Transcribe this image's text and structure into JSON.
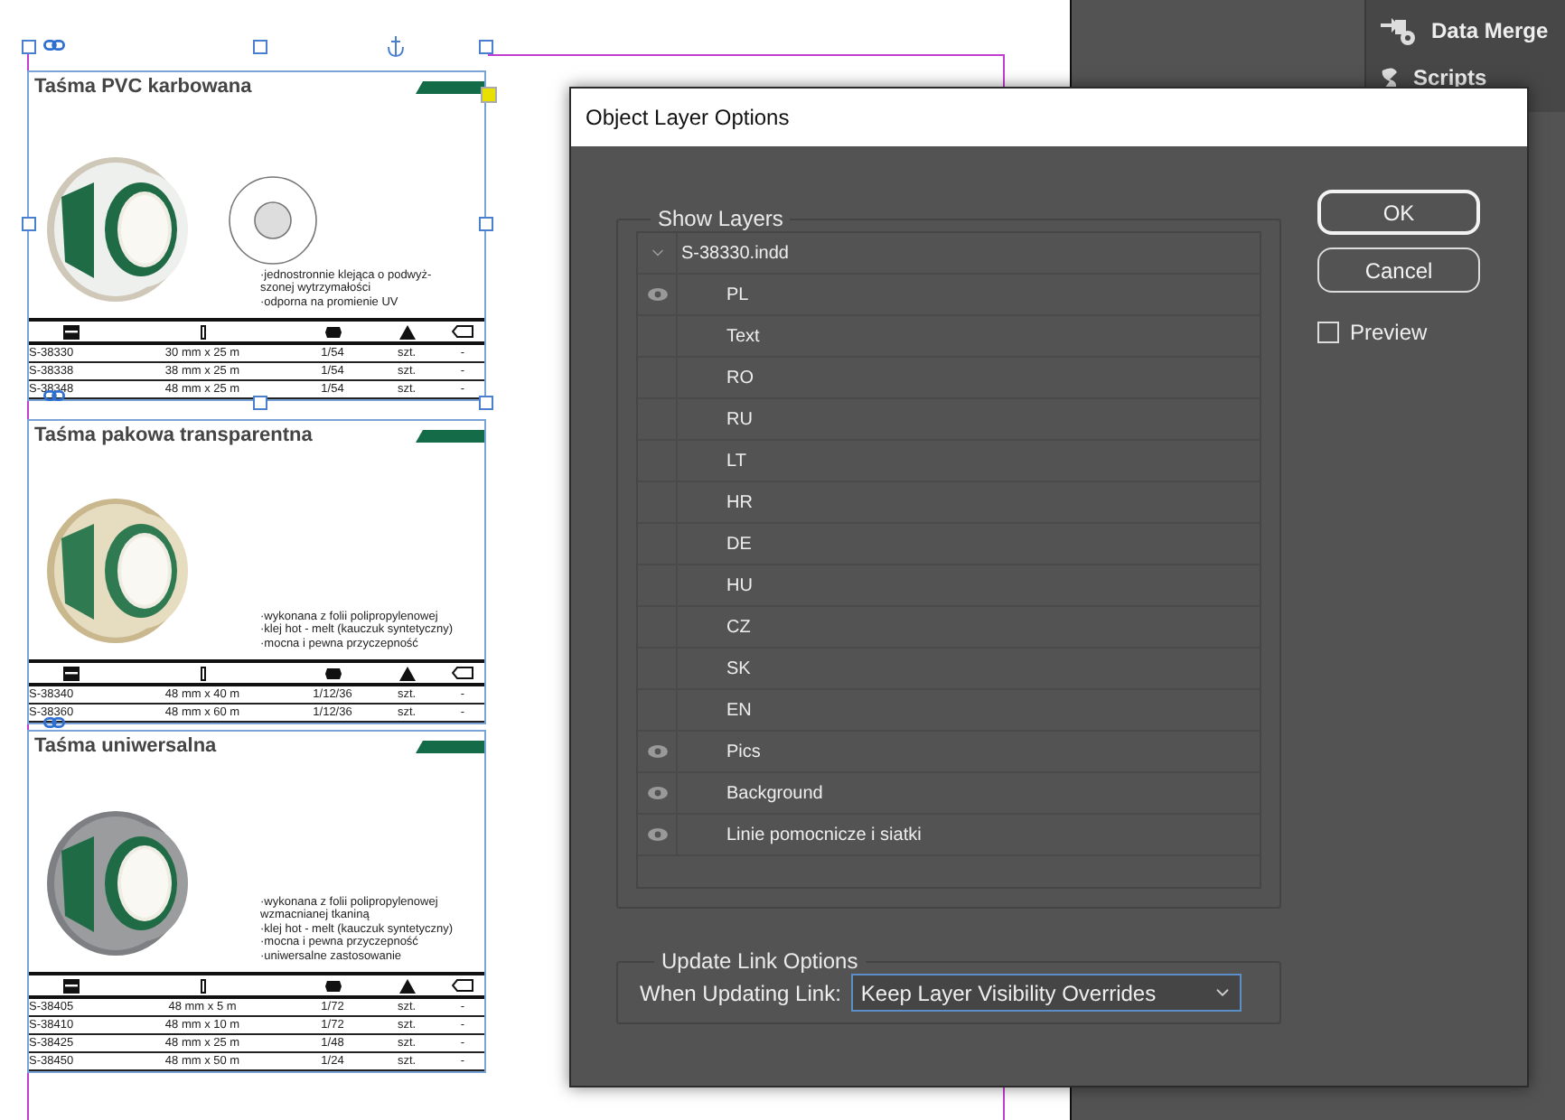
{
  "panel": {
    "items": [
      {
        "kind": "merge",
        "label": "Data Merge"
      },
      {
        "kind": "script",
        "label": "Scripts"
      }
    ]
  },
  "products": [
    {
      "title": "Taśma PVC karbowana",
      "notes": [
        "·jednostronnie klejąca o podwyż-",
        "szonej wytrzymałości",
        "·odporna na promienie UV"
      ],
      "rows": [
        [
          "S-38330",
          "30 mm x 25 m",
          "1/54",
          "szt.",
          "-"
        ],
        [
          "S-38338",
          "38 mm x 25 m",
          "1/54",
          "szt.",
          "-"
        ],
        [
          "S-38348",
          "48 mm x 25 m",
          "1/54",
          "szt.",
          "-"
        ]
      ]
    },
    {
      "title": "Taśma pakowa transparentna",
      "notes": [
        "·wykonana z folii polipropylenowej",
        "·klej hot - melt (kauczuk syntetyczny)",
        "·mocna i pewna przyczepność"
      ],
      "rows": [
        [
          "S-38340",
          "48 mm x 40 m",
          "1/12/36",
          "szt.",
          "-"
        ],
        [
          "S-38360",
          "48 mm x 60 m",
          "1/12/36",
          "szt.",
          "-"
        ]
      ]
    },
    {
      "title": "Taśma uniwersalna",
      "notes": [
        "·wykonana z folii polipropylenowej",
        "wzmacnianej tkaniną",
        "·klej hot - melt (kauczuk syntetyczny)",
        "·mocna i pewna przyczepność",
        "·uniwersalne zastosowanie"
      ],
      "rows": [
        [
          "S-38405",
          "48 mm x 5 m",
          "1/72",
          "szt.",
          "-"
        ],
        [
          "S-38410",
          "48 mm x 10 m",
          "1/72",
          "szt.",
          "-"
        ],
        [
          "S-38425",
          "48 mm x 25 m",
          "1/48",
          "szt.",
          "-"
        ],
        [
          "S-38450",
          "48 mm x 50 m",
          "1/24",
          "szt.",
          "-"
        ]
      ]
    }
  ],
  "dialog": {
    "title": "Object Layer Options",
    "show_layers": {
      "legend": "Show Layers",
      "root": {
        "name": "S-38330.indd",
        "expanded": true,
        "children": [
          {
            "name": "PL",
            "visible": true
          },
          {
            "name": "Text",
            "visible": false
          },
          {
            "name": "RO",
            "visible": false
          },
          {
            "name": "RU",
            "visible": false
          },
          {
            "name": "LT",
            "visible": false
          },
          {
            "name": "HR",
            "visible": false
          },
          {
            "name": "DE",
            "visible": false
          },
          {
            "name": "HU",
            "visible": false
          },
          {
            "name": "CZ",
            "visible": false
          },
          {
            "name": "SK",
            "visible": false
          },
          {
            "name": "EN",
            "visible": false
          },
          {
            "name": "Pics",
            "visible": true
          },
          {
            "name": "Background",
            "visible": true
          },
          {
            "name": "Linie pomocnicze i siatki",
            "visible": true
          }
        ]
      }
    },
    "buttons": [
      "OK",
      "Cancel"
    ],
    "preview": {
      "label": "Preview",
      "checked": false
    },
    "update_link": {
      "legend": "Update Link Options",
      "label": "When Updating Link:",
      "value": "Keep Layer Visibility Overrides"
    }
  }
}
